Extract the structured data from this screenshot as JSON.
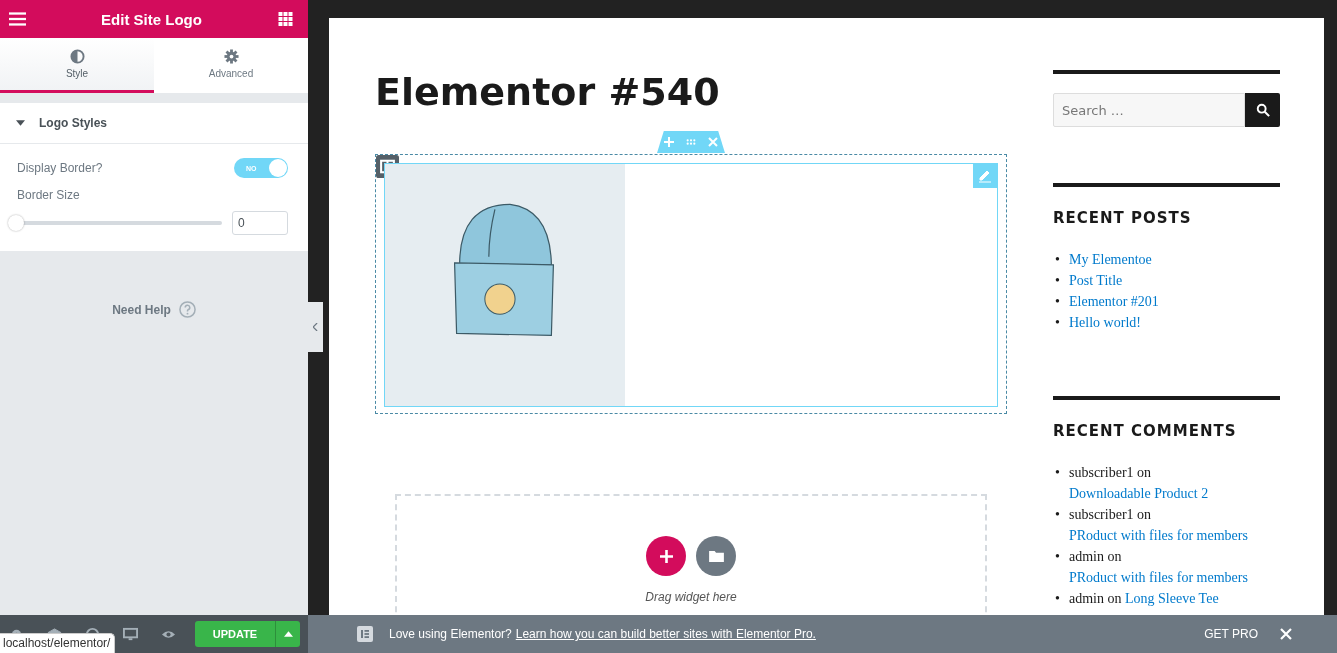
{
  "panel": {
    "title": "Edit Site Logo",
    "tabs": [
      {
        "label": "Style",
        "selected": true
      },
      {
        "label": "Advanced",
        "selected": false
      }
    ],
    "section": {
      "title": "Logo Styles",
      "expanded": true
    },
    "display_border": {
      "label": "Display Border?",
      "on": true,
      "toggle_text": "NO"
    },
    "border_size": {
      "label": "Border Size",
      "level": 0,
      "value": "0"
    },
    "need_help": "Need Help",
    "update_button": "UPDATE",
    "status_tooltip": "localhost/elementor/"
  },
  "page": {
    "title": "Elementor #540",
    "drag_hint": "Drag widget here"
  },
  "sidebar": {
    "search_placeholder": "Search …",
    "recent_posts": {
      "heading": "RECENT POSTS",
      "items": [
        {
          "marker": "•",
          "title": "My Elementoe"
        },
        {
          "marker": "•",
          "title": "Post Title"
        },
        {
          "marker": "•",
          "title": "Elementor #201"
        },
        {
          "marker": "•",
          "title": "Hello world!"
        }
      ]
    },
    "recent_comments": {
      "heading": "RECENT COMMENTS",
      "items": [
        {
          "marker": "•",
          "author": "subscriber1",
          "on": "on",
          "link": "Downloadable Product 2"
        },
        {
          "marker": "•",
          "author": "subscriber1",
          "on": "on",
          "link": "PRoduct with files for members"
        },
        {
          "marker": "•",
          "author": "admin",
          "on": "on",
          "link": "PRoduct with files for members"
        },
        {
          "marker": "•",
          "author": "admin",
          "on": "on",
          "link": "Long Sleeve Tee"
        }
      ]
    }
  },
  "notice": {
    "text": "Love using Elementor?",
    "link": "Learn how you can build better sites with Elementor Pro.",
    "action": "GET PRO"
  }
}
